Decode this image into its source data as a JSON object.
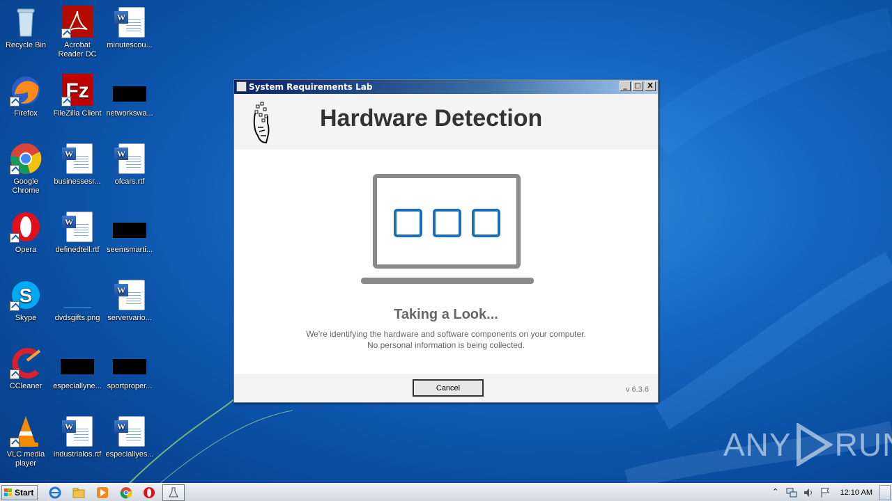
{
  "desktop": {
    "icons": [
      {
        "label": "Recycle Bin"
      },
      {
        "label": "Acrobat Reader DC"
      },
      {
        "label": "minutescou..."
      },
      {
        "label": "Firefox"
      },
      {
        "label": "FileZilla Client"
      },
      {
        "label": "networkswa..."
      },
      {
        "label": "Google Chrome"
      },
      {
        "label": "businessesr..."
      },
      {
        "label": "ofcars.rtf"
      },
      {
        "label": "Opera"
      },
      {
        "label": "definedtell.rtf"
      },
      {
        "label": "seemsmarti..."
      },
      {
        "label": "Skype"
      },
      {
        "label": "dvdsgifts.png"
      },
      {
        "label": "servervario..."
      },
      {
        "label": "CCleaner"
      },
      {
        "label": "especiallyne..."
      },
      {
        "label": "sportproper..."
      },
      {
        "label": "VLC media player"
      },
      {
        "label": "industrialos.rtf"
      },
      {
        "label": "especiallyes..."
      }
    ]
  },
  "window": {
    "title": "System Requirements Lab",
    "controls": {
      "minimize": "_",
      "maximize": "□",
      "close": "X"
    },
    "header_title": "Hardware Detection",
    "status_title": "Taking a Look...",
    "status_desc": "We're identifying the hardware and software components on your computer. No personal information is being collected.",
    "cancel_label": "Cancel",
    "version": "v 6.3.6"
  },
  "watermark": {
    "text_left": "ANY",
    "text_right": "RUN"
  },
  "taskbar": {
    "start_label": "Start",
    "clock": "12:10 AM"
  },
  "colors": {
    "accent_blue": "#1a6ec0",
    "laptop_gray": "#8a8a8a"
  }
}
